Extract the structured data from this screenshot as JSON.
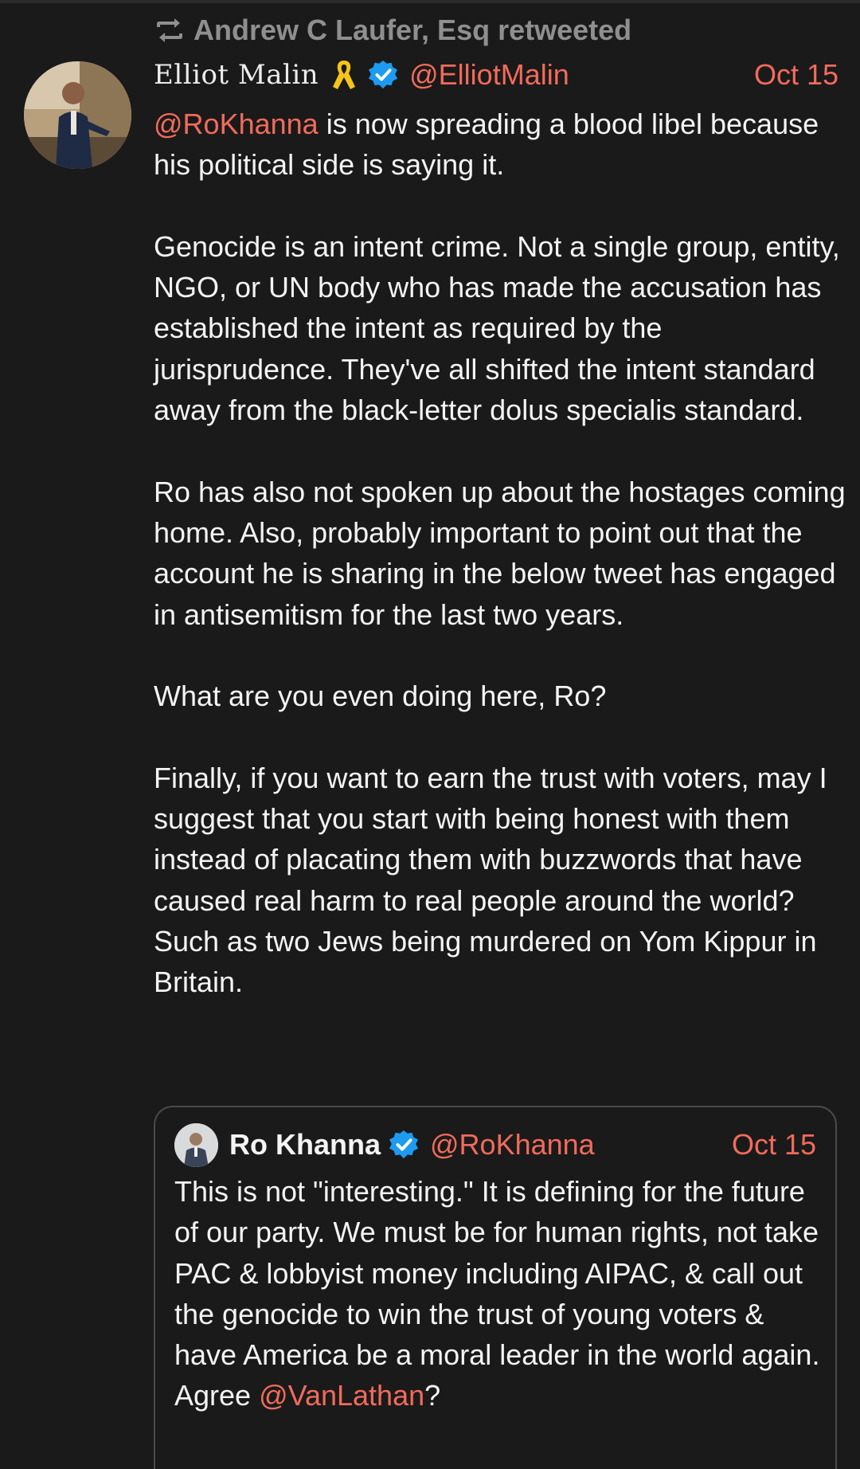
{
  "retweet": {
    "label": "Andrew C Laufer, Esq retweeted",
    "icon": "retweet-icon"
  },
  "tweet": {
    "display_name": "Elliot Malin",
    "handle": "@ElliotMalin",
    "date": "Oct 15",
    "badges": [
      "yellow-ribbon-icon",
      "verified-badge-icon"
    ],
    "paragraphs": [
      {
        "mention": "@RoKhanna",
        "text": " is now spreading a blood libel because his political side is saying it."
      },
      {
        "text": "Genocide is an intent crime. Not a single group, entity, NGO, or UN body who has made the accusation has established the intent as required by the jurisprudence. They've all shifted the intent standard away from the black-letter dolus specialis standard."
      },
      {
        "text": "Ro has also not spoken up about the hostages coming home. Also, probably important to point out that the account he is sharing in the below tweet has engaged in antisemitism for the last two years."
      },
      {
        "text": "What are you even doing here, Ro?"
      },
      {
        "text": "Finally, if you want to earn the trust with voters, may I suggest that you start with being honest with them instead of placating them with buzzwords that have caused real harm to real people around the world? Such as two Jews being murdered on Yom Kippur in Britain."
      }
    ]
  },
  "quote": {
    "display_name": "Ro Khanna",
    "handle": "@RoKhanna",
    "date": "Oct 15",
    "text": "This is not \"interesting.\" It is defining for the future of our party. We must be for human rights, not take PAC & lobbyist money including AIPAC, & call out the genocide to win the trust of young voters & have America be a moral leader in the world again. Agree ",
    "mention": "@VanLathan",
    "suffix": "?"
  },
  "colors": {
    "background": "#1a1a1a",
    "text": "#f4f4f4",
    "muted": "#8f8f8f",
    "accent": "#f26b5b",
    "verified": "#1d9bf0",
    "ribbon": "#f5c518"
  }
}
